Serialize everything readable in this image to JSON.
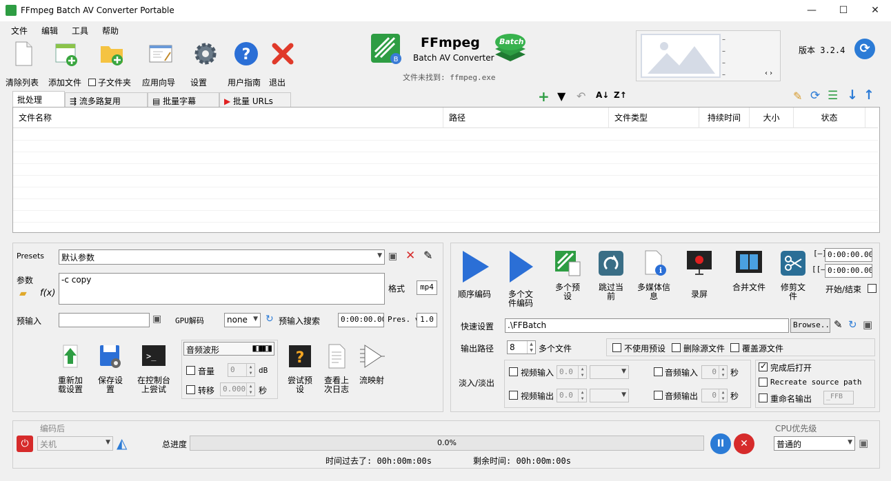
{
  "window": {
    "title": "FFmpeg Batch AV Converter Portable",
    "minimize": "—",
    "maximize": "☐",
    "close": "✕"
  },
  "menu": [
    "文件",
    "编辑",
    "工具",
    "帮助"
  ],
  "toolbar": {
    "clear": "清除列表",
    "add": "添加文件",
    "subfolder": "子文件夹",
    "wizard": "应用向导",
    "settings": "设置",
    "guide": "用户指南",
    "exit": "退出"
  },
  "logo": {
    "name": "FFmpeg",
    "sub": "Batch AV Converter",
    "badge": "Batch",
    "notfound": "文件未找到: ffmpeg.exe"
  },
  "version": "版本 3.2.4",
  "tabs": [
    "批处理",
    "流多路复用",
    "批量字幕",
    "批量 URLs"
  ],
  "columns": [
    "文件名称",
    "路径",
    "文件类型",
    "持续时间",
    "大小",
    "状态"
  ],
  "presets": {
    "label": "Presets",
    "value": "默认参数",
    "params_label": "参数",
    "params_value": "-c copy",
    "format_label": "格式",
    "format_value": "mp4"
  },
  "preinput": {
    "label": "预输入",
    "gpu_label": "GPU解码",
    "gpu_value": "none",
    "search_label": "预输入搜索",
    "time": "0:00:00.000",
    "pres_label": "Pres. v",
    "pres_value": "1.0"
  },
  "left_buttons": [
    "重新加载设置",
    "保存设置",
    "在控制台上尝试",
    "尝试预设",
    "查看上次日志",
    "流映射"
  ],
  "audio": {
    "wave": "音频波形",
    "volume": "音量",
    "volume_value": "0",
    "db": "dB",
    "shift": "转移",
    "shift_value": "0.000",
    "sec": "秒"
  },
  "right_buttons": [
    "顺序编码",
    "多个文件编码",
    "多个预设",
    "跳过当前",
    "多媒体信息",
    "录屏",
    "合并文件",
    "修剪文件"
  ],
  "trim": {
    "start_label": "[–]",
    "end_label": "[[–",
    "start": "0:00:00.000",
    "end": "0:00:00.000",
    "toggle": "开始/结束"
  },
  "quick": {
    "label": "快速设置",
    "value": ".\\FFBatch",
    "browse": "Browse..."
  },
  "output": {
    "label": "输出路径",
    "count": "8",
    "multi": "多个文件",
    "no_preset": "不使用预设",
    "delete_src": "删除源文件",
    "overwrite": "覆盖源文件"
  },
  "fade": {
    "label": "淡入/淡出",
    "vin": "视频输入",
    "vout": "视频输出",
    "ain": "音频输入",
    "aout": "音频输出",
    "vin_v": "0.0",
    "vout_v": "0.0",
    "ain_v": "0",
    "aout_v": "0",
    "sec": "秒"
  },
  "finish": {
    "open": "完成后打开",
    "recreate": "Recreate source path",
    "rename": "重命名输出",
    "suffix": "_FFB"
  },
  "bottom": {
    "after_label": "编码后",
    "after_value": "关机",
    "total": "总进度",
    "progress": "0.0%",
    "progress_fraction": 0,
    "elapsed": "时间过去了: 00h:00m:00s",
    "remaining": "剩余时间: 00h:00m:00s",
    "cpu_label": "CPU优先级",
    "cpu_value": "普通的"
  },
  "colors": {
    "blue": "#2b7bd6",
    "red": "#d62b2b",
    "green": "#2e9d43"
  }
}
